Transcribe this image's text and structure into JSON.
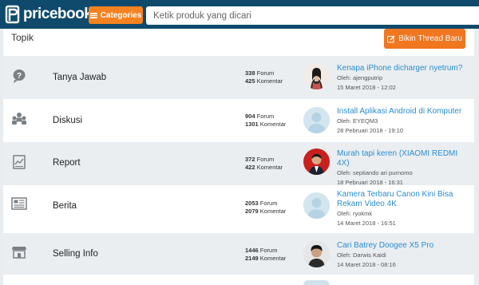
{
  "header": {
    "logo_text": "pricebook",
    "categories_label": "Categories",
    "search_placeholder": "Ketik produk yang dicari"
  },
  "forum": {
    "heading": "Topik",
    "new_thread_label": "Bikin Thread Baru",
    "rows": [
      {
        "title": "Tanya Jawab",
        "forum_count": "338",
        "forum_label": "Forum",
        "comment_count": "425",
        "comment_label": "Komentar",
        "last_post_title": "Kenapa iPhone dicharger nyetrum?",
        "last_post_by": "Oleh: ajengputrip",
        "last_post_date": "15 Maret 2018 - 12:02",
        "icon": "question-icon"
      },
      {
        "title": "Diskusi",
        "forum_count": "904",
        "forum_label": "Forum",
        "comment_count": "1301",
        "comment_label": "Komentar",
        "last_post_title": "Install Aplikasi Android di Komputer",
        "last_post_by": "Oleh: EYEQM3",
        "last_post_date": "28 Pebruari 2018 - 19:10",
        "icon": "users-icon"
      },
      {
        "title": "Report",
        "forum_count": "372",
        "forum_label": "Forum",
        "comment_count": "422",
        "comment_label": "Komentar",
        "last_post_title": "Murah tapi keren (XIAOMI REDMI 4X)",
        "last_post_by": "Oleh: septiando ari purnomo",
        "last_post_date": "18 Pebruari 2018 - 16:31",
        "icon": "report-icon"
      },
      {
        "title": "Berita",
        "forum_count": "2053",
        "forum_label": "Forum",
        "comment_count": "2079",
        "comment_label": "Komentar",
        "last_post_title": "Kamera Terbaru Canon Kini Bisa Rekam Video 4K",
        "last_post_by": "Oleh: ryokmk",
        "last_post_date": "14 Maret 2018 - 16:51",
        "icon": "newspaper-icon"
      },
      {
        "title": "Selling Info",
        "forum_count": "1446",
        "forum_label": "Forum",
        "comment_count": "2149",
        "comment_label": "Komentar",
        "last_post_title": "Cari Batrey Doogee X5 Pro",
        "last_post_by": "Oleh: Darwis Kaidi",
        "last_post_date": "14 Maret 2018 - 08:16",
        "icon": "store-icon"
      }
    ]
  },
  "colors": {
    "header_bg": "#0f4a6d",
    "accent_orange": "#f58220",
    "link_blue": "#2b8ed0",
    "row_alt_bg": "#eaeef1"
  }
}
